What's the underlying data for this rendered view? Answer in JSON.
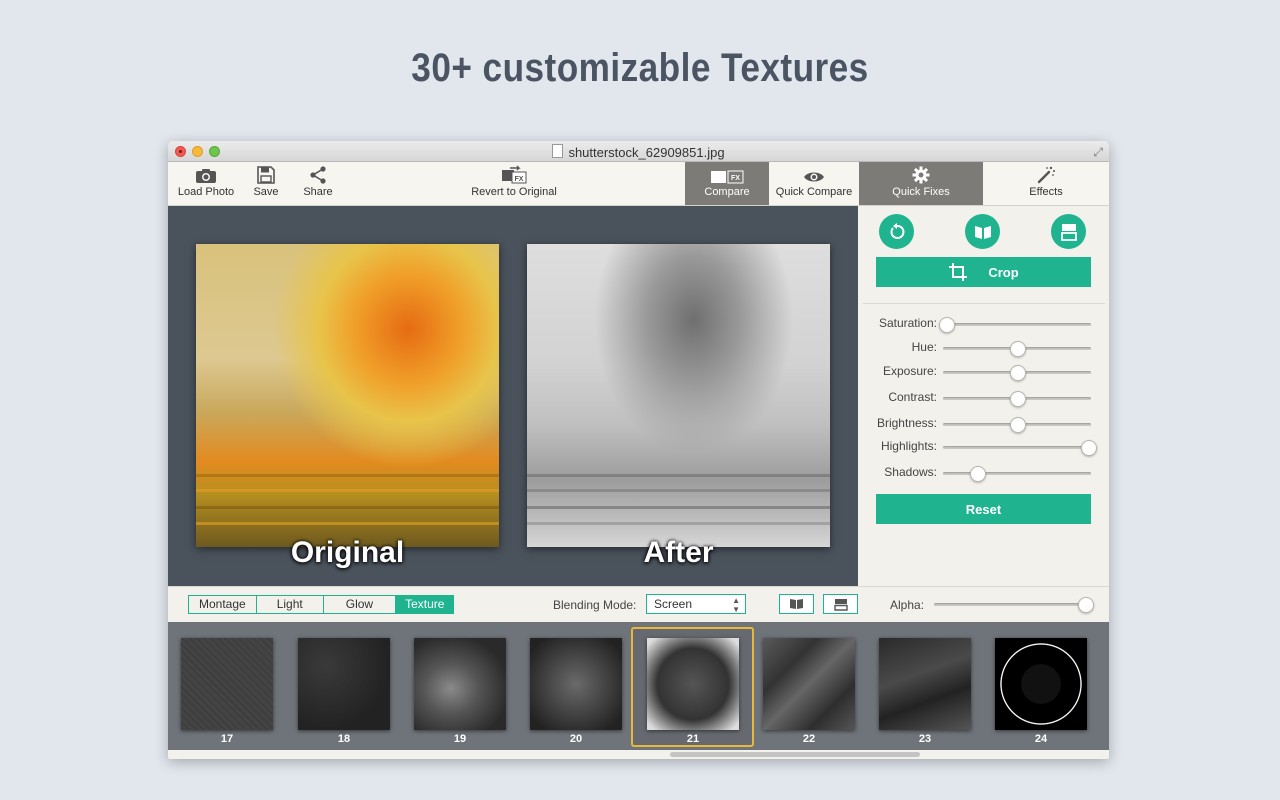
{
  "headline": "30+ customizable Textures",
  "window": {
    "title": "shutterstock_62909851.jpg"
  },
  "toolbar": {
    "load_photo": "Load Photo",
    "save": "Save",
    "share": "Share",
    "revert": "Revert to Original",
    "compare": "Compare",
    "quick_compare": "Quick Compare",
    "quick_fixes": "Quick Fixes",
    "effects": "Effects"
  },
  "preview": {
    "original_label": "Original",
    "after_label": "After"
  },
  "panel": {
    "crop_label": "Crop",
    "reset_label": "Reset",
    "sliders": [
      {
        "label": "Saturation:",
        "value": 0.02
      },
      {
        "label": "Hue:",
        "value": 0.5
      },
      {
        "label": "Exposure:",
        "value": 0.5
      },
      {
        "label": "Contrast:",
        "value": 0.5
      },
      {
        "label": "Brightness:",
        "value": 0.5
      },
      {
        "label": "Highlights:",
        "value": 0.98
      },
      {
        "label": "Shadows:",
        "value": 0.23
      }
    ]
  },
  "bottom": {
    "tabs": [
      "Montage",
      "Light",
      "Glow",
      "Texture"
    ],
    "active_tab": "Texture",
    "blending_label": "Blending Mode:",
    "blending_value": "Screen",
    "alpha_label": "Alpha:",
    "alpha_value": 0.97
  },
  "textures": [
    {
      "num": "17"
    },
    {
      "num": "18"
    },
    {
      "num": "19"
    },
    {
      "num": "20"
    },
    {
      "num": "21",
      "selected": true
    },
    {
      "num": "22"
    },
    {
      "num": "23"
    },
    {
      "num": "24"
    }
  ],
  "colors": {
    "accent": "#1fb48f",
    "selection": "#e8b83a",
    "canvas": "#4a525c"
  }
}
